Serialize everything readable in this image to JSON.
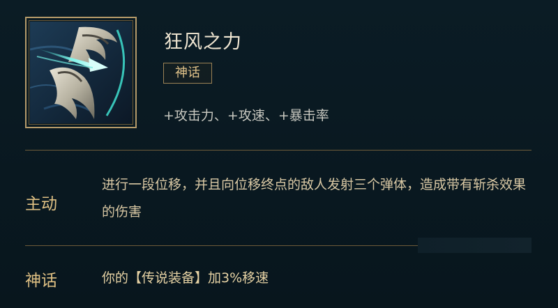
{
  "item": {
    "name": "狂风之力",
    "rarity": "神话",
    "stats": "+攻击力、+攻速、+暴击率",
    "icon": "bow-arrow-icon"
  },
  "sections": {
    "active": {
      "label": "主动",
      "text": "进行一段位移，并且向位移终点的敌人发射三个弹体，造成带有斩杀效果的伤害"
    },
    "mythic": {
      "label": "神话",
      "text": "你的【传说装备】加3%移速"
    }
  },
  "colors": {
    "background": "#0a1a22",
    "gold_border": "#b69b6a",
    "label_gold": "#e0c184",
    "title": "#f0e6d2",
    "accent_cyan": "#3fe0d0"
  }
}
